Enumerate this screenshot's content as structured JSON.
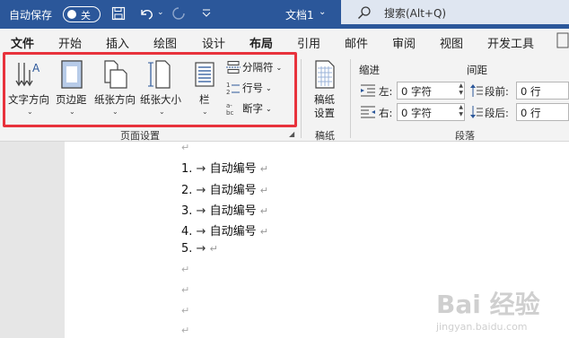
{
  "titlebar": {
    "autosave_label": "自动保存",
    "autosave_state": "关",
    "doc_title": "文档1",
    "doc_title_caret": "⌄",
    "search_placeholder": "搜索(Alt+Q)"
  },
  "tabs": [
    "文件",
    "开始",
    "插入",
    "绘图",
    "设计",
    "布局",
    "引用",
    "邮件",
    "审阅",
    "视图",
    "开发工具"
  ],
  "active_tab": "布局",
  "ribbon": {
    "page_setup": {
      "text_direction": "文字方向",
      "margins": "页边距",
      "orientation": "纸张方向",
      "size": "纸张大小",
      "columns": "栏",
      "breaks": "分隔符",
      "line_numbers": "行号",
      "hyphenation": "断字",
      "group_label": "页面设置"
    },
    "draft": {
      "button": "稿纸\n设置",
      "button_line1": "稿纸",
      "button_line2": "设置",
      "group_label": "稿纸"
    },
    "paragraph": {
      "indent_header": "缩进",
      "spacing_header": "间距",
      "left_label": "左:",
      "right_label": "右:",
      "left_value": "0 字符",
      "right_value": "0 字符",
      "before_label": "段前:",
      "after_label": "段后:",
      "before_value": "0 行",
      "after_value": "0 行",
      "group_label": "段落"
    }
  },
  "document": {
    "list_items": [
      {
        "number": "1.",
        "text": "自动编号"
      },
      {
        "number": "2.",
        "text": "自动编号"
      },
      {
        "number": "3.",
        "text": "自动编号"
      },
      {
        "number": "4.",
        "text": "自动编号"
      },
      {
        "number": "5.",
        "text": ""
      }
    ],
    "paragraph_mark": "↵",
    "tab_arrow": "→"
  },
  "watermark": {
    "logo_text": "Bai 经验",
    "url": "jingyan.baidu.com"
  },
  "colors": {
    "titlebar": "#2b579a",
    "highlight": "#e8323c",
    "ribbon_bg": "#f3f3f3"
  }
}
